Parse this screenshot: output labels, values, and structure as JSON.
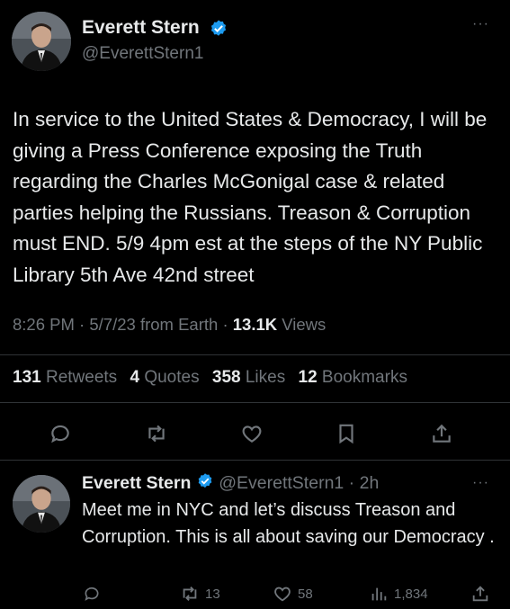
{
  "main_tweet": {
    "display_name": "Everett Stern",
    "handle": "@EverettStern1",
    "more_icon": "ellipsis-icon",
    "text": "In service to the United States & Democracy, I will be giving a Press Conference exposing the Truth regarding the Charles McGonigal case & related parties helping the Russians. Treason & Corruption must END. 5/9 4pm est at the steps of the NY Public Library 5th Ave 42nd street",
    "time": "8:26 PM",
    "date": "5/7/23",
    "source": "from Earth",
    "views_count": "13.1K",
    "views_label": "Views",
    "retweets_count": "131",
    "retweets_label": "Retweets",
    "quotes_count": "4",
    "quotes_label": "Quotes",
    "likes_count": "358",
    "likes_label": "Likes",
    "bookmarks_count": "12",
    "bookmarks_label": "Bookmarks",
    "actions": [
      "reply-icon",
      "retweet-icon",
      "like-icon",
      "bookmark-icon",
      "share-icon"
    ]
  },
  "reply_tweet": {
    "display_name": "Everett Stern",
    "handle": "@EverettStern1",
    "time_ago": "2h",
    "text": "Meet me in NYC and let’s discuss Treason and Corruption. This is all about saving our Democracy .",
    "retweets": "13",
    "likes": "58",
    "views": "1,834"
  },
  "colors": {
    "background": "#000000",
    "text": "#e7e9ea",
    "muted": "#71767b",
    "verified": "#1d9bf0",
    "divider": "#2f3336"
  }
}
